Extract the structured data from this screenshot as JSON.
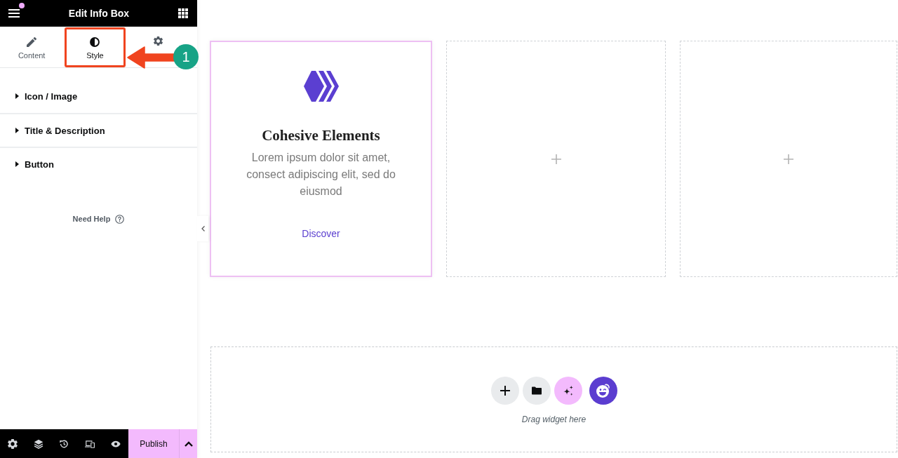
{
  "panel": {
    "title": "Edit Info Box",
    "menu": {
      "notification": true
    },
    "tabs": [
      {
        "kind": "content",
        "label": "Content",
        "selected": false,
        "highlighted": false
      },
      {
        "kind": "style",
        "label": "Style",
        "selected": true,
        "highlighted": true
      },
      {
        "kind": "settings",
        "selected": false,
        "highlighted": false
      }
    ],
    "sections": [
      {
        "label": "Icon / Image",
        "expanded": false
      },
      {
        "label": "Title & Description",
        "expanded": false
      },
      {
        "label": "Button",
        "expanded": false
      }
    ],
    "help": "Need Help"
  },
  "annotation": {
    "badge": "1"
  },
  "footer": {
    "publish": "Publish"
  },
  "canvas": {
    "columns": [
      {
        "kind": "info_box",
        "selected": true,
        "title": "Cohesive Elements",
        "description": "Lorem ipsum dolor sit amet, consect adipiscing elit, sed do eiusmod",
        "link": "Discover"
      },
      {
        "kind": "empty",
        "selected": false
      },
      {
        "kind": "empty",
        "selected": false
      }
    ],
    "dropzone": {
      "hint": "Drag widget here"
    }
  }
}
